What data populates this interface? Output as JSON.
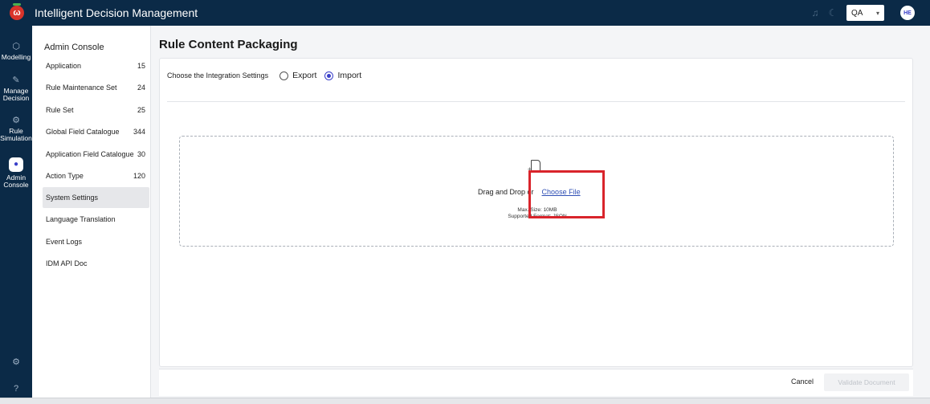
{
  "app": {
    "title": "Intelligent Decision Management",
    "logo_letter": "ω",
    "env": "QA",
    "avatar": "HE"
  },
  "leftnav": {
    "items": [
      {
        "label1": "Modelling",
        "label2": "",
        "icon": "cube-icon"
      },
      {
        "label1": "Manage",
        "label2": "Decision",
        "icon": "edit-icon"
      },
      {
        "label1": "Rule",
        "label2": "Simulation",
        "icon": "gear-box-icon"
      },
      {
        "label1": "Admin",
        "label2": "Console",
        "icon": "admin-icon"
      }
    ]
  },
  "admin": {
    "title": "Admin Console",
    "items": [
      {
        "label": "Application",
        "count": "15"
      },
      {
        "label": "Rule Maintenance Set",
        "count": "24"
      },
      {
        "label": "Rule Set",
        "count": "25"
      },
      {
        "label": "Global Field Catalogue",
        "count": "344"
      },
      {
        "label": "Application Field Catalogue",
        "count": "30"
      },
      {
        "label": "Action Type",
        "count": "120"
      },
      {
        "label": "System Settings",
        "count": ""
      },
      {
        "label": "Language Translation",
        "count": ""
      },
      {
        "label": "Event Logs",
        "count": ""
      },
      {
        "label": "IDM API Doc",
        "count": ""
      }
    ]
  },
  "main": {
    "page_title": "Rule Content Packaging",
    "settings_label": "Choose the Integration Settings",
    "export_label": "Export",
    "import_label": "Import",
    "drag_text": "Drag and Drop or",
    "choose_file": "Choose File",
    "max_size": "Max. Size: 10MB",
    "supported_format": "Supported Format: JSON"
  },
  "footer": {
    "cancel": "Cancel",
    "validate": "Validate Document"
  },
  "colors": {
    "nav_bg": "#0b2a47",
    "accent": "#3a3fc9",
    "highlight": "#d9242b"
  }
}
